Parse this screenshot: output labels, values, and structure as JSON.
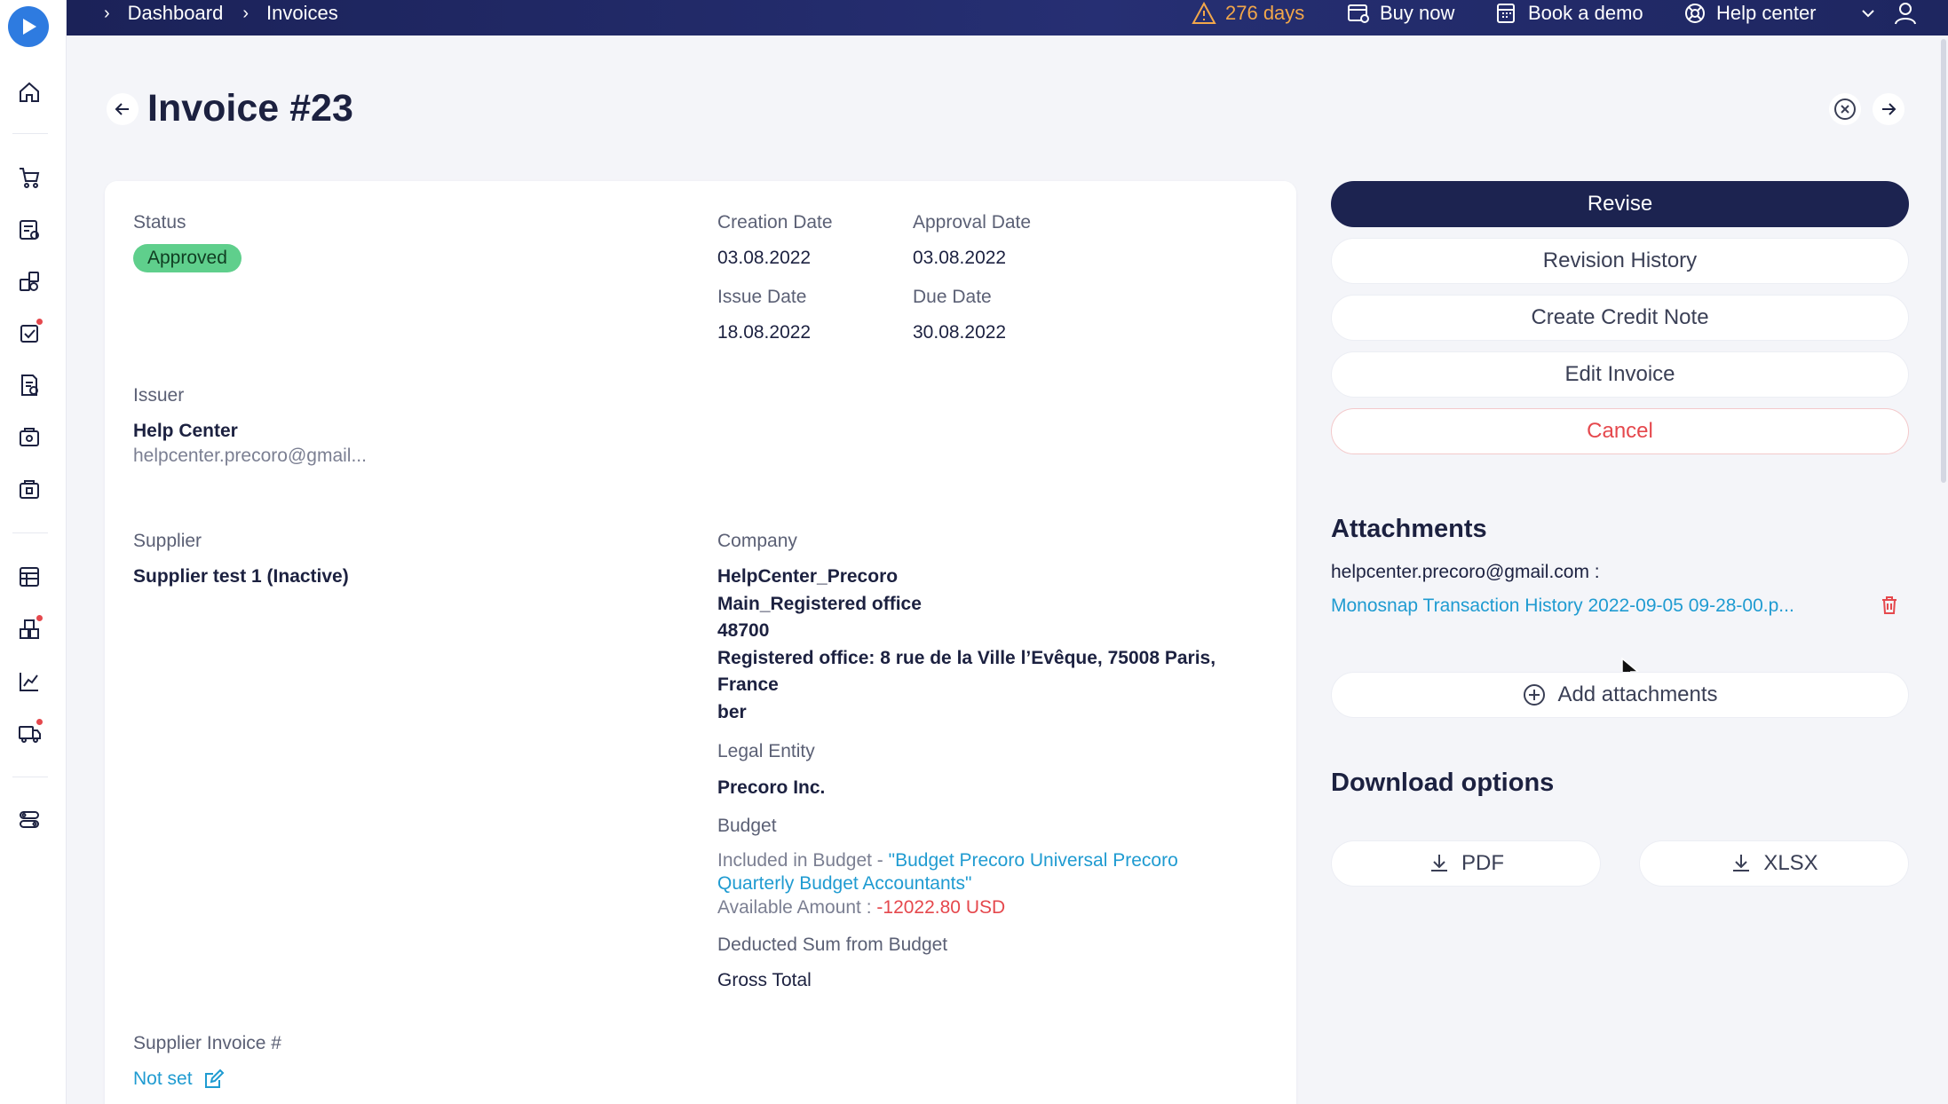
{
  "topbar": {
    "breadcrumb": [
      "Dashboard",
      "Invoices"
    ],
    "trial_days": "276 days",
    "buy_now": "Buy now",
    "book_demo": "Book a demo",
    "help_center": "Help center"
  },
  "header": {
    "title": "Invoice #23"
  },
  "invoice": {
    "status_label": "Status",
    "status_value": "Approved",
    "creation_date_label": "Creation Date",
    "creation_date": "03.08.2022",
    "approval_date_label": "Approval Date",
    "approval_date": "03.08.2022",
    "issue_date_label": "Issue Date",
    "issue_date": "18.08.2022",
    "due_date_label": "Due Date",
    "due_date": "30.08.2022",
    "issuer_label": "Issuer",
    "issuer_name": "Help Center",
    "issuer_email": "helpcenter.precoro@gmail...",
    "supplier_label": "Supplier",
    "supplier_name": "Supplier test 1 (Inactive)",
    "company_label": "Company",
    "company_lines": [
      "HelpCenter_Precoro",
      "Main_Registered office",
      "48700",
      "Registered office: 8 rue de la Ville l’Evêque, 75008 Paris,",
      "France",
      "ber"
    ],
    "legal_entity_label": "Legal Entity",
    "legal_entity": "Precoro Inc.",
    "budget_label": "Budget",
    "budget_included_prefix": "Included in Budget - ",
    "budget_name_line1": "\"Budget Precoro Universal Precoro",
    "budget_name_line2": "Quarterly Budget Accountants\"",
    "available_amount_prefix": "Available Amount : ",
    "available_amount": "-12022.80 USD",
    "deducted_label": "Deducted Sum from Budget",
    "deducted_value": "Gross Total",
    "supplier_invoice_label": "Supplier Invoice #",
    "supplier_invoice_value": "Not set"
  },
  "actions": {
    "revise": "Revise",
    "revision_history": "Revision History",
    "create_credit_note": "Create Credit Note",
    "edit_invoice": "Edit Invoice",
    "cancel": "Cancel"
  },
  "attachments": {
    "title": "Attachments",
    "owner": "helpcenter.precoro@gmail.com :",
    "file_name": "Monosnap Transaction History 2022-09-05 09-28-00.p...",
    "add_label": "Add attachments"
  },
  "download": {
    "title": "Download options",
    "pdf": "PDF",
    "xlsx": "XLSX"
  },
  "colors": {
    "primary": "#1c2350",
    "topbar": "#262f73",
    "link": "#1f9bd1",
    "danger": "#e5484d",
    "success_badge": "#5fcf8c",
    "warning": "#f2a74a"
  }
}
